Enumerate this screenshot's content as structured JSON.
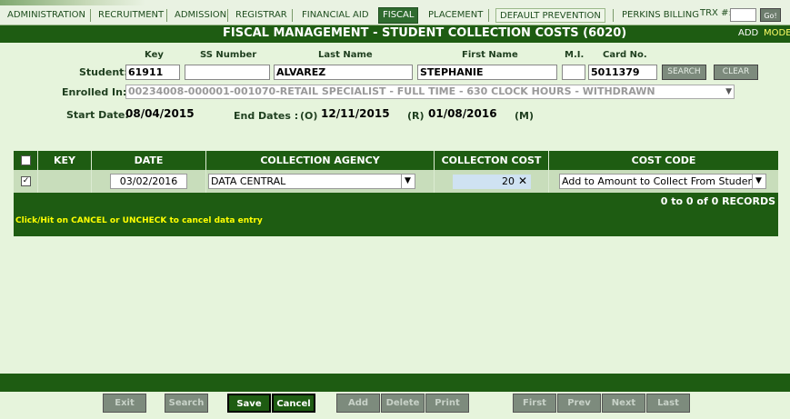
{
  "nav": {
    "items": [
      "ADMINISTRATION",
      "RECRUITMENT",
      "ADMISSION",
      "REGISTRAR",
      "FINANCIAL AID",
      "FISCAL",
      "PLACEMENT",
      "DEFAULT PREVENTION",
      "PERKINS BILLING"
    ],
    "trx_label": "TRX #:",
    "go_label": "Go!"
  },
  "page": {
    "title": "FISCAL MANAGEMENT - STUDENT COLLECTION COSTS (6020)",
    "add_label": "ADD",
    "mode_label": "MODE"
  },
  "student": {
    "headers": {
      "key": "Key",
      "ssn": "SS Number",
      "last": "Last Name",
      "first": "First Name",
      "mi": "M.I.",
      "card": "Card No."
    },
    "label": "Student:",
    "key": "61911",
    "ssn": "",
    "last_name": "ALVAREZ",
    "first_name": "STEPHANIE",
    "mi": "",
    "card_no": "5011379",
    "search_btn": "SEARCH",
    "clear_btn": "CLEAR"
  },
  "enrollment": {
    "label": "Enrolled In:",
    "value": "00234008-000001-001070-RETAIL SPECIALIST - FULL TIME - 630 CLOCK HOURS - WITHDRAWN",
    "start_label": "Start Date:",
    "start_date": "08/04/2015",
    "end_label": "End Dates :",
    "o_label": "(O)",
    "o_date": "12/11/2015",
    "r_label": "(R)",
    "r_date": "01/08/2016",
    "m_label": "(M)"
  },
  "grid": {
    "columns": [
      "KEY",
      "DATE",
      "COLLECTION AGENCY",
      "COLLECTON COST",
      "COST CODE"
    ],
    "row": {
      "checked": "✓",
      "key": "",
      "date": "03/02/2016",
      "agency": "DATA CENTRAL",
      "cost": "20",
      "cost_code": "Add to Amount to Collect From Student"
    },
    "records": "0 to 0 of 0 RECORDS",
    "hint": "Click/Hit on CANCEL or UNCHECK to cancel data entry"
  },
  "buttons": {
    "exit": "Exit",
    "search": "Search",
    "save": "Save",
    "cancel": "Cancel",
    "add": "Add",
    "delete": "Delete",
    "print": "Print",
    "first": "First",
    "prev": "Prev",
    "next": "Next",
    "last": "Last"
  },
  "colors": {
    "header_green": "#1e5c12",
    "background": "#e6f4dc",
    "mode_yellow": "#ffff66"
  }
}
